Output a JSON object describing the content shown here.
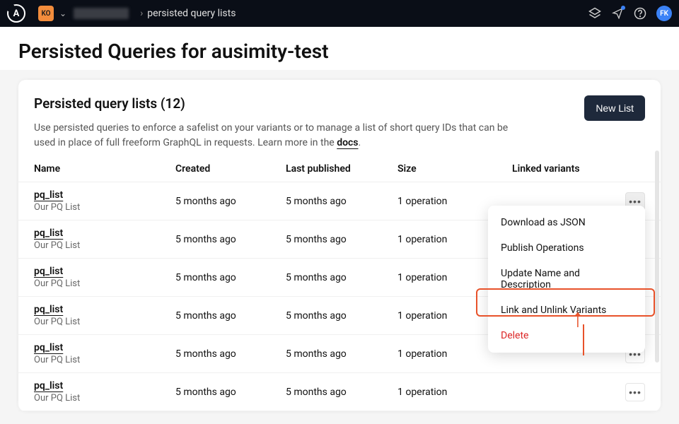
{
  "topbar": {
    "logo_letter": "A",
    "org_badge": "KO",
    "breadcrumb_current": "persisted query lists",
    "avatar": "FK"
  },
  "page": {
    "title": "Persisted Queries for ausimity-test"
  },
  "card": {
    "title": "Persisted query lists (12)",
    "description_prefix": "Use persisted queries to enforce a safelist on your variants or to manage a list of short query IDs that can be used in place of full freeform GraphQL in requests. Learn more in the ",
    "docs_label": "docs",
    "description_suffix": ".",
    "new_list_label": "New List"
  },
  "columns": {
    "name": "Name",
    "created": "Created",
    "last_published": "Last published",
    "size": "Size",
    "linked_variants": "Linked variants"
  },
  "rows": [
    {
      "name": "pq_list",
      "sub": "Our PQ List",
      "created": "5 months ago",
      "last_published": "5 months ago",
      "size": "1 operation"
    },
    {
      "name": "pq_list",
      "sub": "Our PQ List",
      "created": "5 months ago",
      "last_published": "5 months ago",
      "size": "1 operation"
    },
    {
      "name": "pq_list",
      "sub": "Our PQ List",
      "created": "5 months ago",
      "last_published": "5 months ago",
      "size": "1 operation"
    },
    {
      "name": "pq_list",
      "sub": "Our PQ List",
      "created": "5 months ago",
      "last_published": "5 months ago",
      "size": "1 operation"
    },
    {
      "name": "pq_list",
      "sub": "Our PQ List",
      "created": "5 months ago",
      "last_published": "5 months ago",
      "size": "1 operation"
    },
    {
      "name": "pq_list",
      "sub": "Our PQ List",
      "created": "5 months ago",
      "last_published": "5 months ago",
      "size": "1 operation"
    }
  ],
  "dropdown": {
    "download": "Download as JSON",
    "publish": "Publish Operations",
    "update": "Update Name and Description",
    "link": "Link and Unlink Variants",
    "delete": "Delete"
  }
}
